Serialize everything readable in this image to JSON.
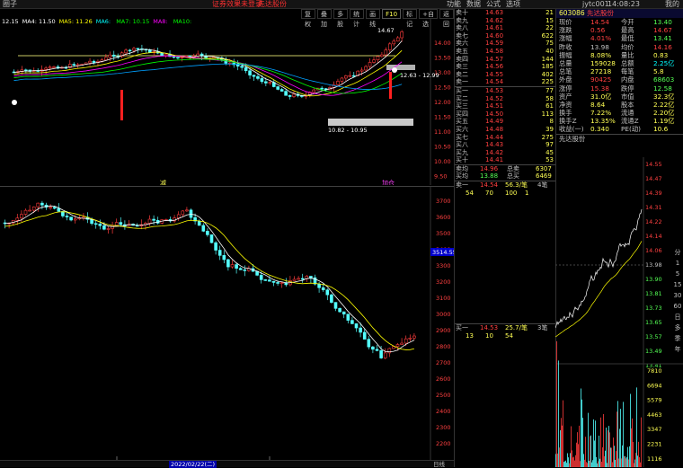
{
  "topbar": {
    "left": "圈子",
    "notice1": "证券效果未登录",
    "notice2": "先达股份",
    "menu": [
      "功能",
      "数据",
      "公式",
      "选项"
    ],
    "code_label": "jytc001",
    "time": "14:08:23",
    "tail": "我的"
  },
  "toolbar": [
    "复权",
    "叠加",
    "多股",
    "统计",
    "画线",
    "F10",
    "标记",
    "+自选",
    "返回"
  ],
  "ma_legend": [
    {
      "t": "12.15",
      "c": "#ffffff"
    },
    {
      "t": "MA4: 11.50",
      "c": "#ffffff"
    },
    {
      "t": "MA5: 11.26",
      "c": "#ffff00"
    },
    {
      "t": "MA6: ",
      "c": "#00ffff"
    },
    {
      "t": "MA7: 10.15",
      "c": "#00ff00"
    },
    {
      "t": "MA8: ",
      "c": "#ff00ff"
    },
    {
      "t": "MA10: ",
      "c": "#00ff00"
    }
  ],
  "top_chart": {
    "y_labels": [
      "14.00",
      "13.50",
      "13.00",
      "12.50",
      "12.00",
      "11.50",
      "11.00",
      "10.50",
      "10.00",
      "9.50"
    ],
    "annotations": {
      "high": "14.67",
      "low_mid": "12.63 - 12.99",
      "low": "10.82 - 10.95"
    },
    "markers": {
      "left": "减",
      "right": "加仓"
    }
  },
  "mid_chart": {
    "y_labels": [
      "3700",
      "3600",
      "3500",
      "3400",
      "3300",
      "3200",
      "3100",
      "3000",
      "2900",
      "2800",
      "2700",
      "2600",
      "2500",
      "2400",
      "2300",
      "2200"
    ],
    "current": "3514.55"
  },
  "bottom_strip": {
    "date_label": "2022/02/22(二)",
    "right_label": "日线"
  },
  "order_book": {
    "sells": [
      {
        "l": "卖十",
        "p": "14.63",
        "v": "21"
      },
      {
        "l": "卖九",
        "p": "14.62",
        "v": "15"
      },
      {
        "l": "卖八",
        "p": "14.61",
        "v": "22"
      },
      {
        "l": "卖七",
        "p": "14.60",
        "v": "622"
      },
      {
        "l": "卖六",
        "p": "14.59",
        "v": "75"
      },
      {
        "l": "卖五",
        "p": "14.58",
        "v": "40"
      },
      {
        "l": "卖四",
        "p": "14.57",
        "v": "144"
      },
      {
        "l": "卖三",
        "p": "14.56",
        "v": "185"
      },
      {
        "l": "卖二",
        "p": "14.55",
        "v": "402"
      },
      {
        "l": "卖一",
        "p": "14.54",
        "v": "225"
      }
    ],
    "buys": [
      {
        "l": "买一",
        "p": "14.53",
        "v": "77"
      },
      {
        "l": "买二",
        "p": "14.52",
        "v": "58"
      },
      {
        "l": "买三",
        "p": "14.51",
        "v": "61"
      },
      {
        "l": "买四",
        "p": "14.50",
        "v": "113"
      },
      {
        "l": "买五",
        "p": "14.49",
        "v": "8"
      },
      {
        "l": "买六",
        "p": "14.48",
        "v": "39"
      },
      {
        "l": "买七",
        "p": "14.44",
        "v": "275"
      },
      {
        "l": "买八",
        "p": "14.43",
        "v": "97"
      },
      {
        "l": "买九",
        "p": "14.42",
        "v": "45"
      },
      {
        "l": "买十",
        "p": "14.41",
        "v": "53"
      }
    ],
    "sell_avg": {
      "l": "卖均",
      "p": "14.96",
      "k": "总卖",
      "v": "6307"
    },
    "buy_avg": {
      "l": "买均",
      "p": "13.88",
      "k": "总买",
      "v": "6469"
    },
    "sell1_row": {
      "l": "卖一",
      "p": "14.54",
      "q": "56.3/笔",
      "n": "4笔"
    },
    "sell1_detail": [
      "54",
      "70",
      "100",
      "1"
    ],
    "buy1_row": {
      "l": "买一",
      "p": "14.53",
      "q": "25.7/笔",
      "n": "3笔"
    },
    "buy1_detail": [
      "13",
      "10",
      "54"
    ]
  },
  "stock": {
    "code": "603086",
    "name": "先达股份",
    "sub": "先达股份",
    "rows": [
      [
        {
          "k": "现价",
          "v": "14.54"
        },
        {
          "k": "今开",
          "v": "13.40"
        }
      ],
      [
        {
          "k": "涨跌",
          "v": "0.56"
        },
        {
          "k": "最高",
          "v": "14.67"
        }
      ],
      [
        {
          "k": "涨幅",
          "v": "4.01%"
        },
        {
          "k": "最低",
          "v": "13.41"
        }
      ],
      [
        {
          "k": "昨收",
          "v": "13.98"
        },
        {
          "k": "均价",
          "v": "14.16"
        }
      ],
      [
        {
          "k": "振幅",
          "v": "8.08%"
        },
        {
          "k": "量比",
          "v": "0.83"
        }
      ],
      [
        {
          "k": "总量",
          "v": "159028"
        },
        {
          "k": "总额",
          "v": "2.25亿"
        }
      ],
      [
        {
          "k": "总笔",
          "v": "27218"
        },
        {
          "k": "每笔",
          "v": "5.8"
        }
      ],
      [
        {
          "k": "外盘",
          "v": "90425"
        },
        {
          "k": "内盘",
          "v": "68603"
        }
      ],
      [
        {
          "k": "涨停",
          "v": "15.38"
        },
        {
          "k": "跌停",
          "v": "12.58"
        }
      ],
      [
        {
          "k": "资产",
          "v": "31.0亿"
        },
        {
          "k": "市值",
          "v": "32.3亿"
        }
      ],
      [
        {
          "k": "净资",
          "v": "8.64"
        },
        {
          "k": "股本",
          "v": "2.22亿"
        }
      ],
      [
        {
          "k": "换手",
          "v": "7.22%"
        },
        {
          "k": "流通",
          "v": "2.20亿"
        }
      ],
      [
        {
          "k": "换手Z",
          "v": "13.35%"
        },
        {
          "k": "流通Z",
          "v": "1.19亿"
        }
      ],
      [
        {
          "k": "收益(一)",
          "v": "0.340"
        },
        {
          "k": "PE(动)",
          "v": "10.6"
        }
      ]
    ]
  },
  "mini": {
    "price_labels": [
      "14.55",
      "14.47",
      "14.39",
      "14.31",
      "14.22",
      "14.14",
      "14.06",
      "13.98",
      "13.90",
      "13.81",
      "13.73",
      "13.65",
      "13.57",
      "13.49",
      "13.41"
    ],
    "vol_labels": [
      "7810",
      "6694",
      "5579",
      "4463",
      "3347",
      "2231",
      "1116"
    ]
  },
  "side_tabs": [
    "分",
    "1",
    "5",
    "15",
    "30",
    "60",
    "日",
    "多",
    "季",
    "年"
  ]
}
